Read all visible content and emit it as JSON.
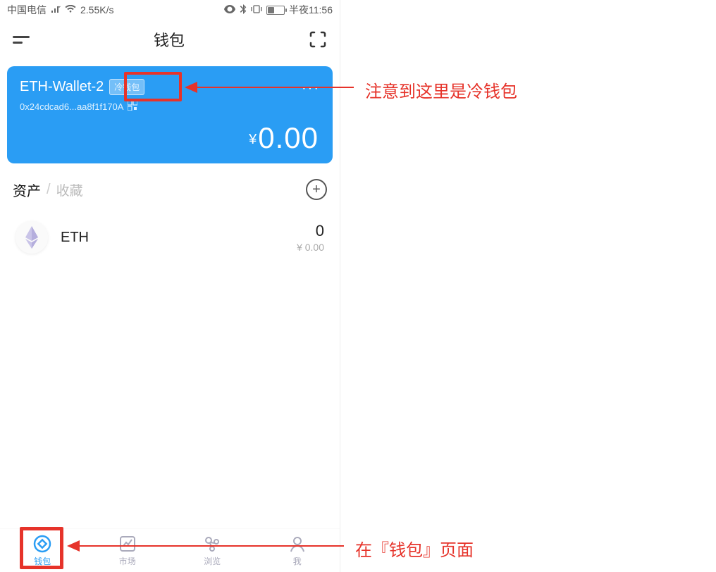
{
  "status": {
    "carrier": "中国电信",
    "speed": "2.55K/s",
    "battery_text": "40",
    "time": "半夜11:56"
  },
  "header": {
    "title": "钱包"
  },
  "card": {
    "wallet_name": "ETH-Wallet-2",
    "badge": "冷钱包",
    "address": "0x24cdcad6...aa8f1f170A",
    "currency_symbol": "¥",
    "balance": "0.00"
  },
  "assets": {
    "tab_assets": "资产",
    "tab_favorites": "收藏",
    "items": [
      {
        "symbol": "ETH",
        "qty": "0",
        "fiat": "¥ 0.00"
      }
    ]
  },
  "tabbar": {
    "wallet": "钱包",
    "market": "市场",
    "browse": "浏览",
    "me": "我"
  },
  "annotations": {
    "cold_wallet": "注意到这里是冷钱包",
    "wallet_page": "在『钱包』页面"
  }
}
